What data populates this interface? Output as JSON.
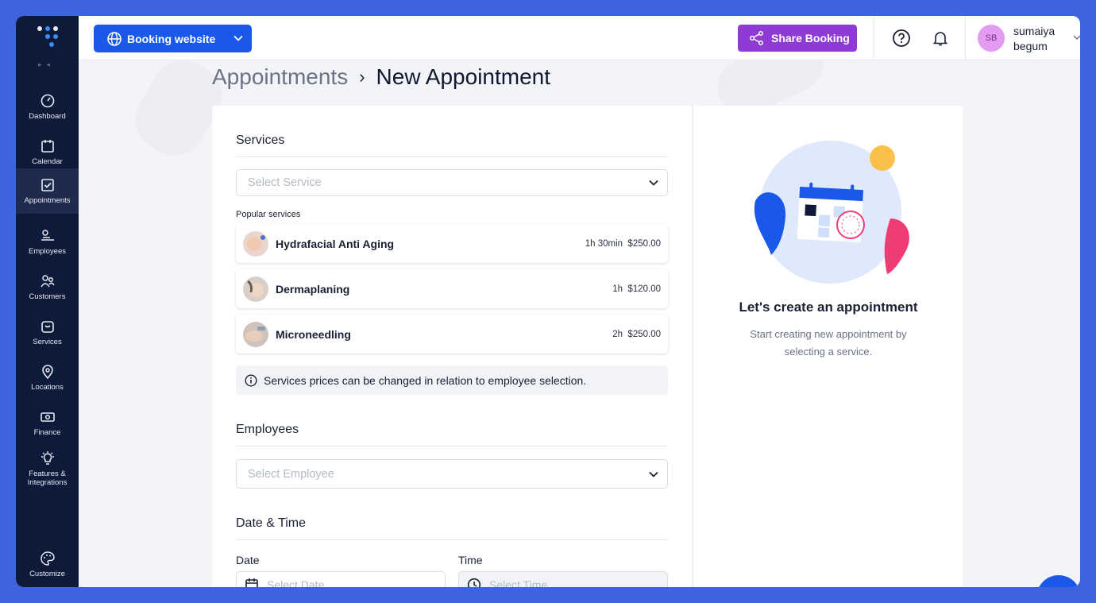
{
  "sidebar": {
    "items": [
      {
        "label": "Dashboard",
        "icon": "dashboard-icon"
      },
      {
        "label": "Calendar",
        "icon": "calendar-icon"
      },
      {
        "label": "Appointments",
        "icon": "appointments-icon",
        "active": true
      },
      {
        "label": "Employees",
        "icon": "employees-icon"
      },
      {
        "label": "Customers",
        "icon": "customers-icon"
      },
      {
        "label": "Services",
        "icon": "services-icon"
      },
      {
        "label": "Locations",
        "icon": "location-pin-icon"
      },
      {
        "label": "Finance",
        "icon": "finance-icon"
      },
      {
        "label": "Features & Integrations",
        "icon": "lightbulb-icon"
      }
    ],
    "customize_label": "Customize"
  },
  "header": {
    "booking_website_label": "Booking website",
    "share_booking_label": "Share Booking",
    "user": {
      "initials": "SB",
      "name": "sumaiya begum"
    }
  },
  "breadcrumb": {
    "parent": "Appointments",
    "separator": "›",
    "current": "New Appointment"
  },
  "form": {
    "services": {
      "title": "Services",
      "select_placeholder": "Select Service",
      "popular_label": "Popular services",
      "popular": [
        {
          "name": "Hydrafacial Anti Aging",
          "duration": "1h 30min",
          "price": "$250.00"
        },
        {
          "name": "Dermaplaning",
          "duration": "1h",
          "price": "$120.00"
        },
        {
          "name": "Microneedling",
          "duration": "2h",
          "price": "$250.00"
        }
      ],
      "info": "Services prices can be changed in relation to employee selection."
    },
    "employees": {
      "title": "Employees",
      "select_placeholder": "Select Employee"
    },
    "datetime": {
      "title": "Date & Time",
      "date_label": "Date",
      "date_placeholder": "Select Date",
      "time_label": "Time",
      "time_placeholder": "Select Time"
    }
  },
  "empty_state": {
    "title": "Let's create an appointment",
    "subtitle": "Start creating new appointment by selecting a service."
  },
  "colors": {
    "sidebar_bg": "#0d1a3a",
    "primary_blue": "#1958e8",
    "share_purple": "#8e3bd6",
    "avatar_pink": "#e49cf2"
  }
}
